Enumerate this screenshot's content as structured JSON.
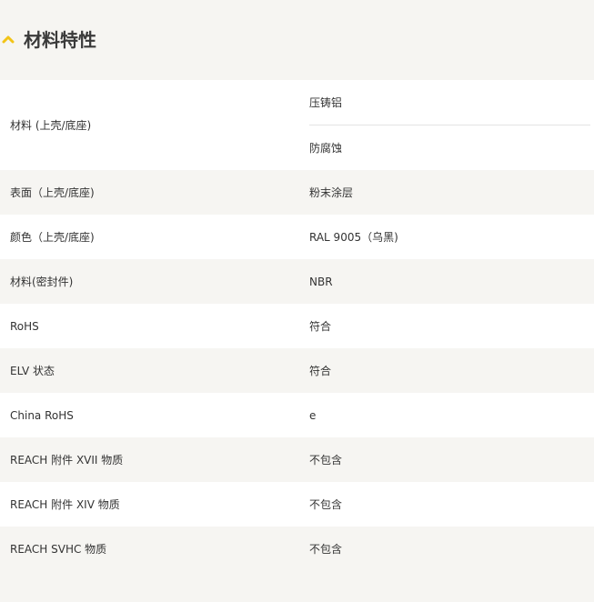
{
  "section": {
    "title": "材料特性"
  },
  "colors": {
    "accent": "#f2c417",
    "row_white": "#ffffff",
    "row_grey": "#f6f5f2"
  },
  "rows": [
    {
      "label": "材料 (上壳/底座)",
      "values": [
        "压铸铝",
        "防腐蚀"
      ]
    },
    {
      "label": "表面（上壳/底座)",
      "value": "粉末涂层"
    },
    {
      "label": "颜色（上壳/底座)",
      "value": "RAL 9005（乌黑)"
    },
    {
      "label": "材料(密封件)",
      "value": "NBR"
    },
    {
      "label": "RoHS",
      "value": "符合"
    },
    {
      "label": "ELV 状态",
      "value": "符合"
    },
    {
      "label": "China RoHS",
      "value": "e"
    },
    {
      "label": "REACH 附件 XVII 物质",
      "value": "不包含"
    },
    {
      "label": "REACH 附件 XIV 物质",
      "value": "不包含"
    },
    {
      "label": "REACH SVHC 物质",
      "value": "不包含"
    }
  ]
}
